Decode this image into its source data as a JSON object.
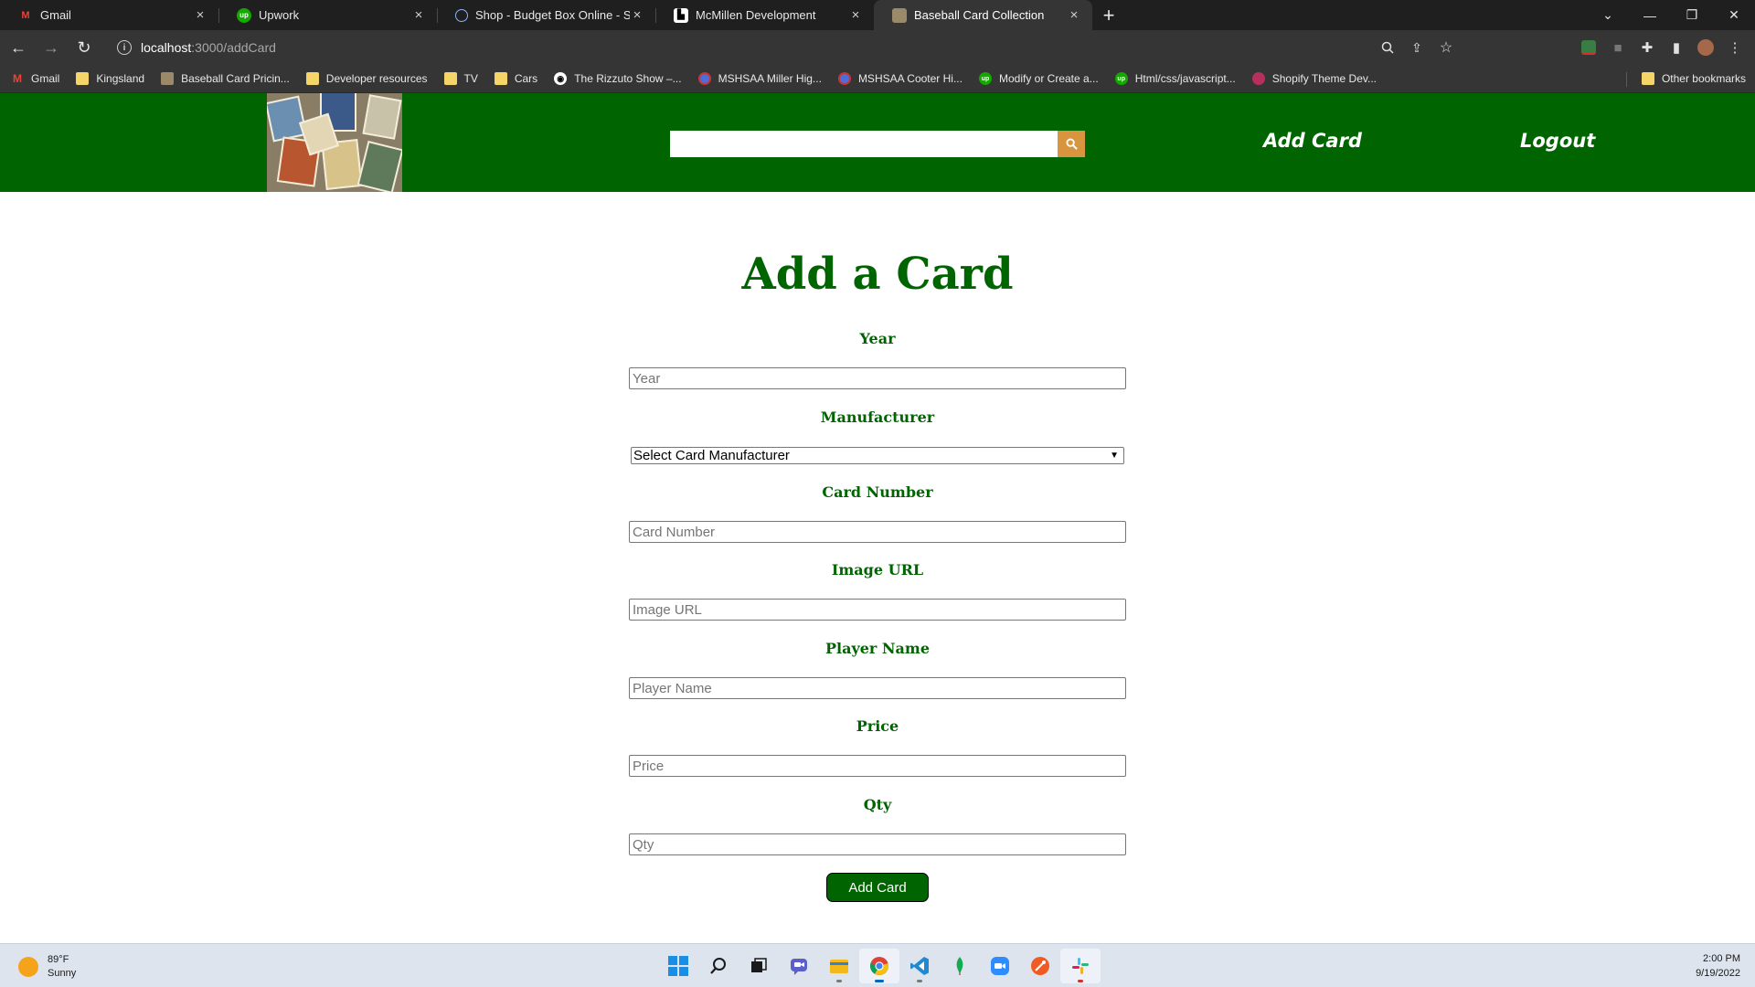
{
  "browser": {
    "tabs": [
      {
        "title": "Gmail",
        "icon": "gmail-icon",
        "active": false
      },
      {
        "title": "Upwork",
        "icon": "upwork-icon",
        "active": false
      },
      {
        "title": "Shop - Budget Box Online - Sout",
        "icon": "page-icon",
        "active": false
      },
      {
        "title": "McMillen Development",
        "icon": "site-icon",
        "active": false
      },
      {
        "title": "Baseball Card Collection",
        "icon": "baseball-card-icon",
        "active": true
      }
    ],
    "new_tab_label": "+",
    "window_controls": {
      "minimize": "—",
      "restore": "❐",
      "close": "✕"
    },
    "url_host": "localhost",
    "url_path": ":3000/addCard",
    "bookmarks": [
      {
        "label": "Gmail",
        "icon": "gmail-icon"
      },
      {
        "label": "Kingsland",
        "icon": "folder-icon"
      },
      {
        "label": "Baseball Card Pricin...",
        "icon": "baseball-card-icon"
      },
      {
        "label": "Developer resources",
        "icon": "folder-icon"
      },
      {
        "label": "TV",
        "icon": "folder-icon"
      },
      {
        "label": "Cars",
        "icon": "folder-icon"
      },
      {
        "label": "The Rizzuto Show –...",
        "icon": "podcast-icon"
      },
      {
        "label": "MSHSAA Miller Hig...",
        "icon": "mshsaa-icon"
      },
      {
        "label": "MSHSAA Cooter Hi...",
        "icon": "mshsaa-icon"
      },
      {
        "label": "Modify or Create a...",
        "icon": "upwork-icon"
      },
      {
        "label": "Html/css/javascript...",
        "icon": "upwork-icon"
      },
      {
        "label": "Shopify Theme Dev...",
        "icon": "shopify-icon"
      }
    ],
    "other_bookmarks": "Other bookmarks"
  },
  "site": {
    "search_placeholder": "",
    "nav": {
      "add_card": "Add Card",
      "logout": "Logout"
    }
  },
  "form": {
    "heading": "Add a Card",
    "fields": {
      "year": {
        "label": "Year",
        "placeholder": "Year"
      },
      "manufacturer": {
        "label": "Manufacturer",
        "selected": "Select Card Manufacturer"
      },
      "card_number": {
        "label": "Card Number",
        "placeholder": "Card Number"
      },
      "image_url": {
        "label": "Image URL",
        "placeholder": "Image URL"
      },
      "player_name": {
        "label": "Player Name",
        "placeholder": "Player Name"
      },
      "price": {
        "label": "Price",
        "placeholder": "Price"
      },
      "qty": {
        "label": "Qty",
        "placeholder": "Qty"
      }
    },
    "submit_label": "Add Card"
  },
  "taskbar": {
    "weather_temp": "89°F",
    "weather_desc": "Sunny",
    "time": "2:00 PM",
    "date": "9/19/2022",
    "apps": [
      "windows-start-icon",
      "search-icon",
      "task-view-icon",
      "teams-icon",
      "file-explorer-icon",
      "chrome-icon",
      "vscode-icon",
      "mongodb-icon",
      "zoom-icon",
      "postman-icon",
      "slack-icon"
    ]
  },
  "colors": {
    "brand_green": "#006400",
    "search_button": "#d8953e",
    "tab_strip": "#1f1f1f",
    "toolbar": "#353535"
  }
}
